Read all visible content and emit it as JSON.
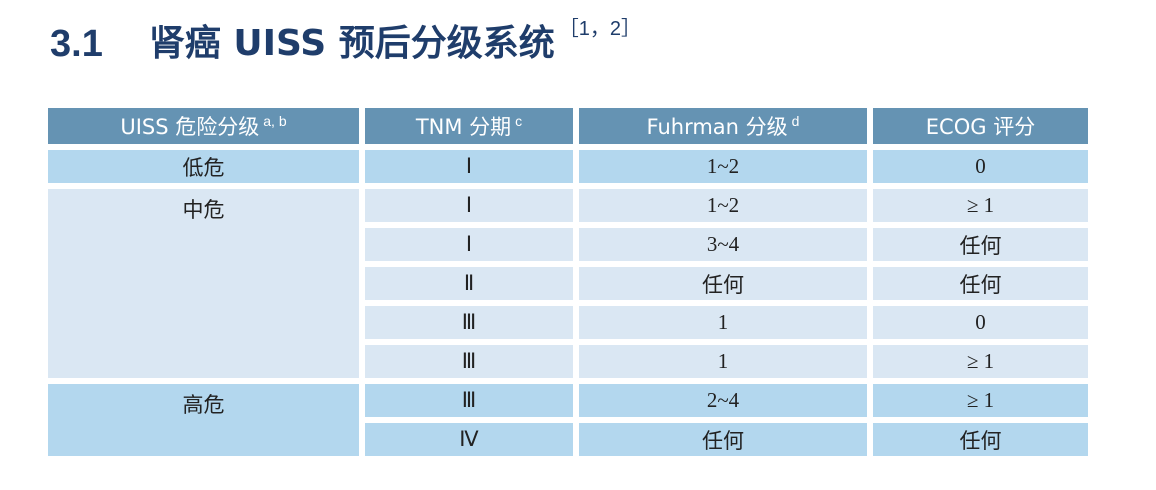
{
  "section": {
    "number": "3.1",
    "title": "肾癌 UISS 预后分级系统",
    "ref": "［1，2］"
  },
  "table": {
    "headers": [
      {
        "label": "UISS 危险分级",
        "sup": "a, b"
      },
      {
        "label": "TNM 分期",
        "sup": "c"
      },
      {
        "label": "Fuhrman 分级",
        "sup": "d"
      },
      {
        "label": "ECOG 评分",
        "sup": ""
      }
    ],
    "groups": [
      {
        "risk": "低危",
        "rows": [
          {
            "tnm": "Ⅰ",
            "fuhrman": "1~2",
            "ecog": "0"
          }
        ]
      },
      {
        "risk": "中危",
        "rows": [
          {
            "tnm": "Ⅰ",
            "fuhrman": "1~2",
            "ecog": "≥ 1"
          },
          {
            "tnm": "Ⅰ",
            "fuhrman": "3~4",
            "ecog": "任何"
          },
          {
            "tnm": "Ⅱ",
            "fuhrman": "任何",
            "ecog": "任何"
          },
          {
            "tnm": "Ⅲ",
            "fuhrman": "1",
            "ecog": "0"
          },
          {
            "tnm": "Ⅲ",
            "fuhrman": "1",
            "ecog": "≥ 1"
          }
        ]
      },
      {
        "risk": "高危",
        "rows": [
          {
            "tnm": "Ⅲ",
            "fuhrman": "2~4",
            "ecog": "≥ 1"
          },
          {
            "tnm": "Ⅳ",
            "fuhrman": "任何",
            "ecog": "任何"
          }
        ]
      }
    ]
  },
  "colors": {
    "header_bg": "#6593b3",
    "row_blue": "#b3d7ee",
    "row_pale": "#dae7f3",
    "title_text": "#1f3d6b"
  }
}
